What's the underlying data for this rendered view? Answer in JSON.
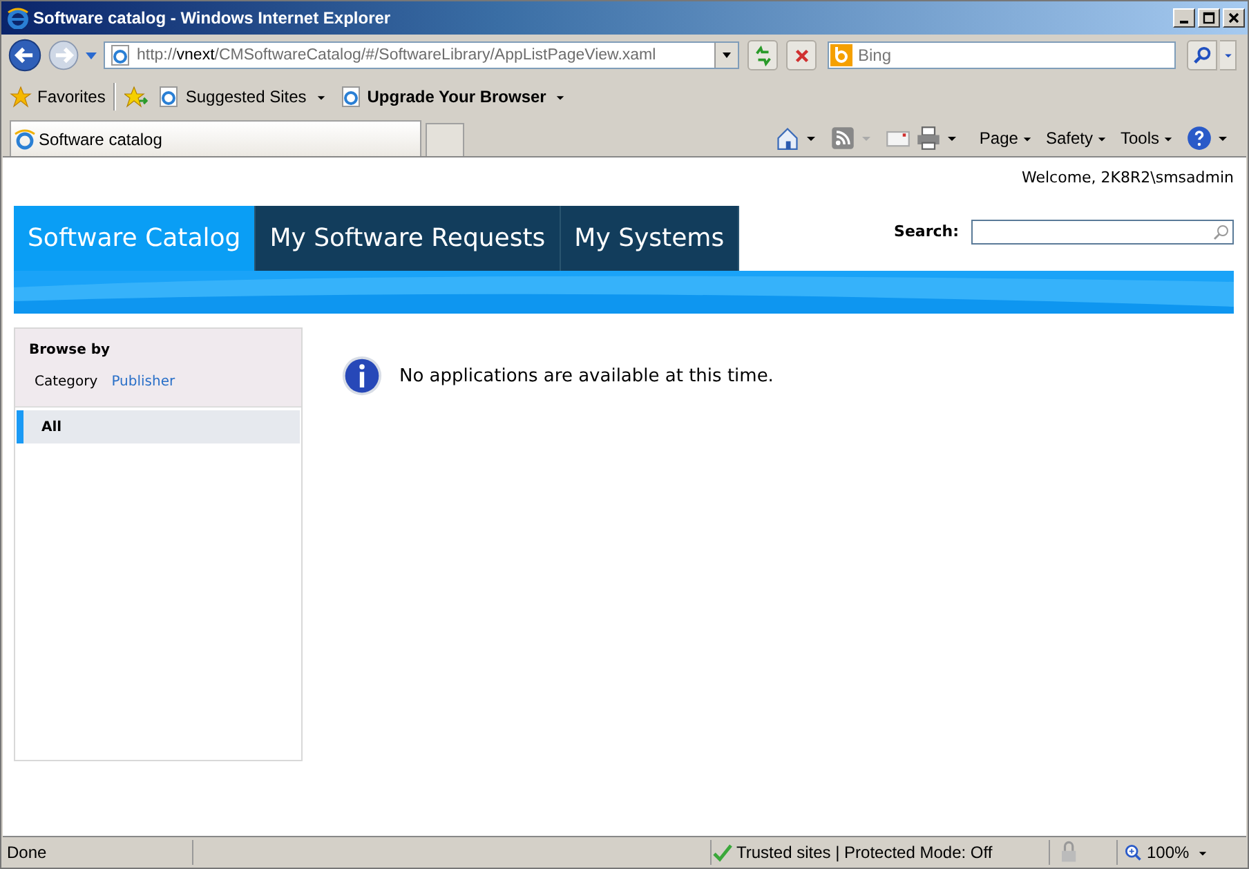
{
  "window": {
    "title": "Software catalog - Windows Internet Explorer"
  },
  "address_bar": {
    "prefix": "http://",
    "host": "vnext",
    "path": "/CMSoftwareCatalog/#/SoftwareLibrary/AppListPageView.xaml"
  },
  "search_box": {
    "placeholder": "Bing"
  },
  "favorites_bar": {
    "favorites": "Favorites",
    "links": [
      {
        "label": "Suggested Sites",
        "bold": false
      },
      {
        "label": "Upgrade Your Browser",
        "bold": true
      }
    ]
  },
  "tabs": [
    {
      "label": "Software catalog",
      "selected": true
    }
  ],
  "command_bar": [
    "Page",
    "Safety",
    "Tools"
  ],
  "page": {
    "welcome": "Welcome, 2K8R2\\smsadmin",
    "nav_tabs": [
      {
        "label": "Software Catalog",
        "selected": true
      },
      {
        "label": "My Software Requests",
        "selected": false
      },
      {
        "label": "My Systems",
        "selected": false
      }
    ],
    "search_label": "Search:",
    "browse": {
      "title": "Browse by",
      "options": [
        {
          "label": "Category",
          "selected": true
        },
        {
          "label": "Publisher",
          "selected": false
        }
      ],
      "items": [
        {
          "label": "All",
          "selected": true
        }
      ]
    },
    "message": "No applications are available at this time."
  },
  "status_bar": {
    "status": "Done",
    "zone": "Trusted sites | Protected Mode: Off",
    "zoom": "100%"
  }
}
